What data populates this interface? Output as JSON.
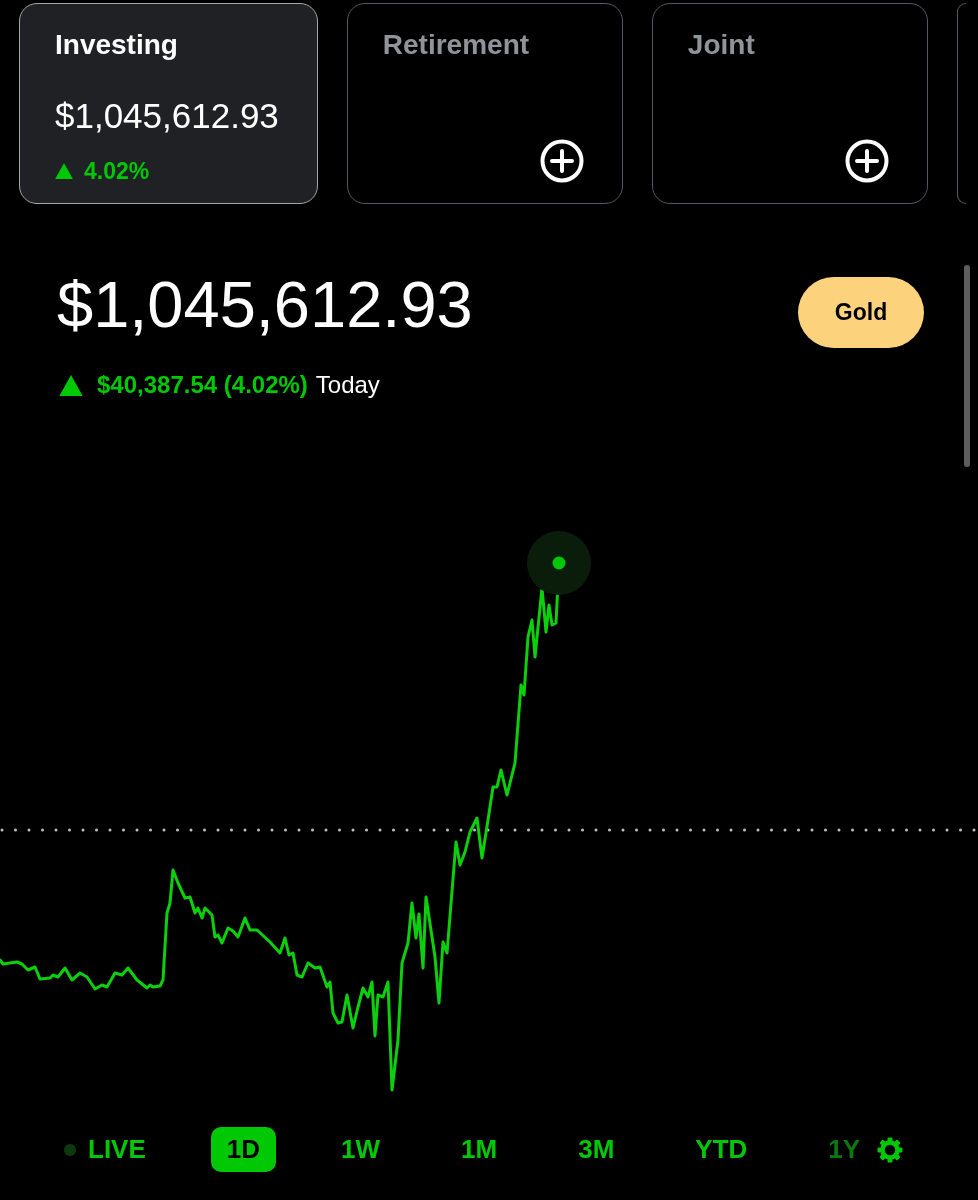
{
  "accounts": [
    {
      "kind": "balance",
      "title": "Investing",
      "selected": true,
      "value": "$1,045,612.93",
      "change": "4.02%",
      "gain": true
    },
    {
      "kind": "add",
      "title": "Retirement",
      "selected": false
    },
    {
      "kind": "add",
      "title": "Joint",
      "selected": false
    }
  ],
  "portfolio": {
    "value": "$1,045,612.93",
    "change": "$40,387.54 (4.02%)",
    "period": "Today",
    "gain": true
  },
  "upgrade_button": {
    "label": "Gold"
  },
  "ranges": [
    {
      "kind": "live",
      "label": "LIVE",
      "selected": false,
      "active": false,
      "dimmed": false
    },
    {
      "kind": "range",
      "label": "1D",
      "selected": true,
      "dimmed": false
    },
    {
      "kind": "range",
      "label": "1W",
      "selected": false,
      "dimmed": false
    },
    {
      "kind": "range",
      "label": "1M",
      "selected": false,
      "dimmed": false
    },
    {
      "kind": "range",
      "label": "3M",
      "selected": false,
      "dimmed": false
    },
    {
      "kind": "range",
      "label": "YTD",
      "selected": false,
      "dimmed": false
    },
    {
      "kind": "range",
      "label": "1Y",
      "selected": false,
      "dimmed": true
    }
  ]
}
